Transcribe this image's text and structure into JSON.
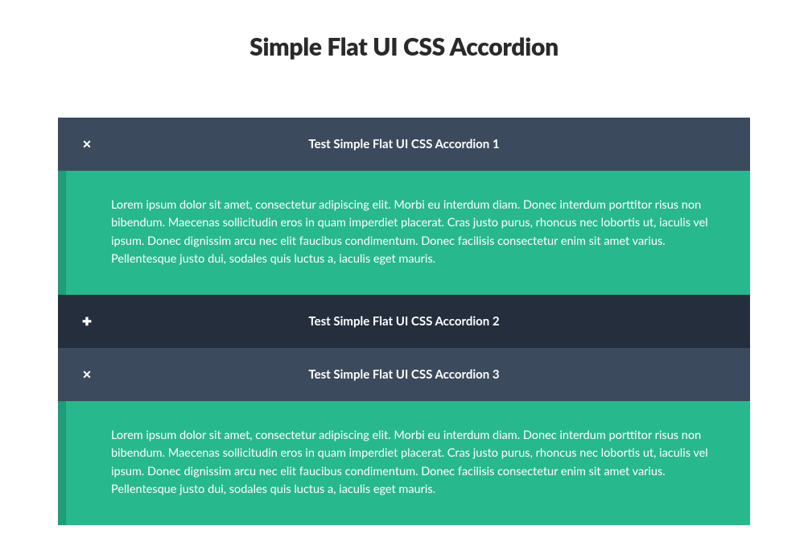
{
  "title": "Simple Flat UI CSS Accordion",
  "items": [
    {
      "label": "Test Simple Flat UI CSS Accordion 1",
      "expanded": true,
      "body": "Lorem ipsum dolor sit amet, consectetur adipiscing elit. Morbi eu interdum diam. Donec interdum porttitor risus non bibendum. Maecenas sollicitudin eros in quam imperdiet placerat. Cras justo purus, rhoncus nec lobortis ut, iaculis vel ipsum. Donec dignissim arcu nec elit faucibus condimentum. Donec facilisis consectetur enim sit amet varius. Pellentesque justo dui, sodales quis luctus a, iaculis eget mauris."
    },
    {
      "label": "Test Simple Flat UI CSS Accordion 2",
      "expanded": false,
      "body": ""
    },
    {
      "label": "Test Simple Flat UI CSS Accordion 3",
      "expanded": true,
      "body": "Lorem ipsum dolor sit amet, consectetur adipiscing elit. Morbi eu interdum diam. Donec interdum porttitor risus non bibendum. Maecenas sollicitudin eros in quam imperdiet placerat. Cras justo purus, rhoncus nec lobortis ut, iaculis vel ipsum. Donec dignissim arcu nec elit faucibus condimentum. Donec facilisis consectetur enim sit amet varius. Pellentesque justo dui, sodales quis luctus a, iaculis eget mauris."
    }
  ]
}
